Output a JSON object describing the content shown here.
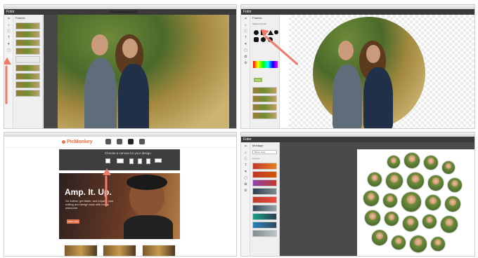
{
  "app": {
    "logo_text": "Fotor"
  },
  "panel1": {
    "title": "Frames",
    "tools": [
      "crop-icon",
      "zoom-icon",
      "info-icon",
      "text-icon",
      "heart-icon",
      "frame-icon"
    ]
  },
  "panel2": {
    "title": "Frames",
    "subtitle": "Shape Cutouts",
    "apply_label": "Apply"
  },
  "picmonkey": {
    "logo_text": "PicMonkey",
    "choose_title": "Choose a canvas for your design",
    "nav_labels": [
      "Edit",
      "Touch Up",
      "Design",
      "Collage"
    ],
    "ratio_labels": [
      "Square",
      "Custom size",
      "4 × 6",
      "5 × 7",
      "8 × 10",
      "Facebook"
    ],
    "hero_title": "Amp. It. Up.",
    "hero_sub": "Go further, get faster, and expand your editing and design tools with image awesome",
    "hero_button": "Learn more"
  },
  "panel4": {
    "title": "Montage",
    "dropdown": "Blank circle",
    "section": "Layouts"
  },
  "colors": {
    "accent": "#e5734f",
    "arrow": "#f07a6c",
    "dark_bg": "#474747"
  },
  "icons": [
    "crop-icon",
    "zoom-icon",
    "info-icon",
    "text-icon",
    "heart-icon",
    "frame-icon",
    "sticker-icon",
    "gear-icon"
  ]
}
